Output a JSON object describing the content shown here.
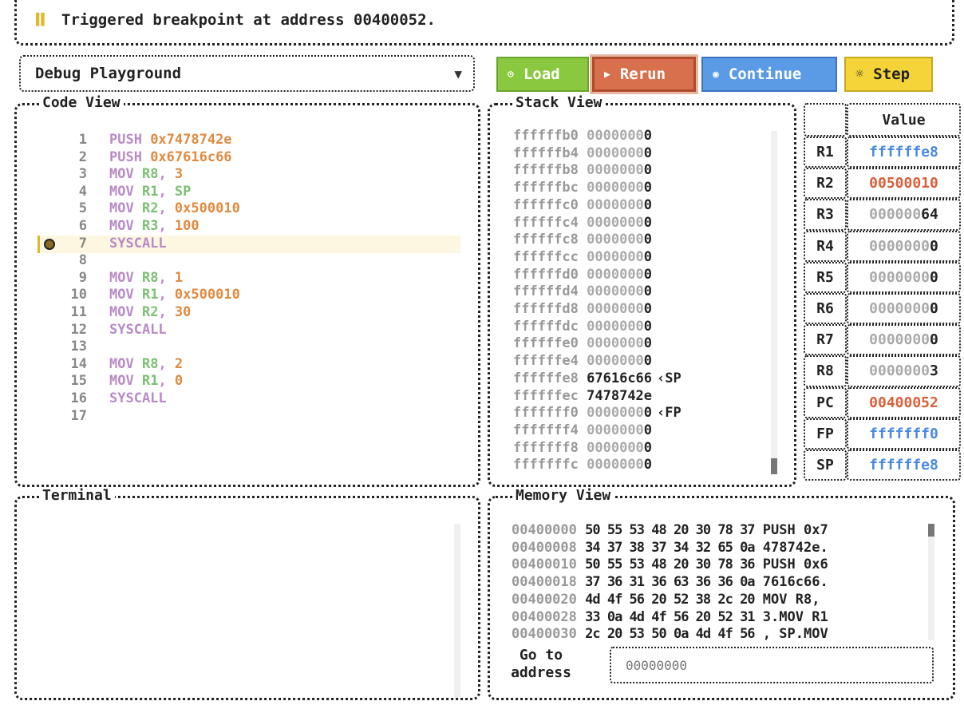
{
  "status": {
    "message": "Triggered breakpoint at address 00400052."
  },
  "program": {
    "selected": "Debug Playground"
  },
  "toolbar": {
    "load": "Load",
    "rerun": "Rerun",
    "continue": "Continue",
    "step": "Step"
  },
  "code": {
    "title": "Code View",
    "lines": [
      {
        "n": "1",
        "parts": [
          [
            "kw",
            "PUSH "
          ],
          [
            "nm",
            "0x7478742e"
          ]
        ]
      },
      {
        "n": "2",
        "parts": [
          [
            "kw",
            "PUSH "
          ],
          [
            "nm",
            "0x67616c66"
          ]
        ]
      },
      {
        "n": "3",
        "parts": [
          [
            "kw",
            "MOV "
          ],
          [
            "rg",
            "R8"
          ],
          [
            "kw",
            ", "
          ],
          [
            "nm",
            "3"
          ]
        ]
      },
      {
        "n": "4",
        "parts": [
          [
            "kw",
            "MOV "
          ],
          [
            "rg",
            "R1"
          ],
          [
            "kw",
            ", "
          ],
          [
            "rg",
            "SP"
          ]
        ]
      },
      {
        "n": "5",
        "parts": [
          [
            "kw",
            "MOV "
          ],
          [
            "rg",
            "R2"
          ],
          [
            "kw",
            ", "
          ],
          [
            "nm",
            "0x500010"
          ]
        ]
      },
      {
        "n": "6",
        "parts": [
          [
            "kw",
            "MOV "
          ],
          [
            "rg",
            "R3"
          ],
          [
            "kw",
            ", "
          ],
          [
            "nm",
            "100"
          ]
        ]
      },
      {
        "n": "7",
        "parts": [
          [
            "kw",
            "SYSCALL"
          ]
        ],
        "active": true
      },
      {
        "n": "8",
        "parts": []
      },
      {
        "n": "9",
        "parts": [
          [
            "kw",
            "MOV "
          ],
          [
            "rg",
            "R8"
          ],
          [
            "kw",
            ", "
          ],
          [
            "nm",
            "1"
          ]
        ]
      },
      {
        "n": "10",
        "parts": [
          [
            "kw",
            "MOV "
          ],
          [
            "rg",
            "R1"
          ],
          [
            "kw",
            ", "
          ],
          [
            "nm",
            "0x500010"
          ]
        ]
      },
      {
        "n": "11",
        "parts": [
          [
            "kw",
            "MOV "
          ],
          [
            "rg",
            "R2"
          ],
          [
            "kw",
            ", "
          ],
          [
            "nm",
            "30"
          ]
        ]
      },
      {
        "n": "12",
        "parts": [
          [
            "kw",
            "SYSCALL"
          ]
        ]
      },
      {
        "n": "13",
        "parts": []
      },
      {
        "n": "14",
        "parts": [
          [
            "kw",
            "MOV "
          ],
          [
            "rg",
            "R8"
          ],
          [
            "kw",
            ", "
          ],
          [
            "nm",
            "2"
          ]
        ]
      },
      {
        "n": "15",
        "parts": [
          [
            "kw",
            "MOV "
          ],
          [
            "rg",
            "R1"
          ],
          [
            "kw",
            ", "
          ],
          [
            "nm",
            "0"
          ]
        ]
      },
      {
        "n": "16",
        "parts": [
          [
            "kw",
            "SYSCALL"
          ]
        ]
      },
      {
        "n": "17",
        "parts": []
      }
    ]
  },
  "stack": {
    "title": "Stack View",
    "rows": [
      {
        "addr": "ffffffb0",
        "val": "00000000",
        "mark": ""
      },
      {
        "addr": "ffffffb4",
        "val": "00000000",
        "mark": ""
      },
      {
        "addr": "ffffffb8",
        "val": "00000000",
        "mark": ""
      },
      {
        "addr": "ffffffbc",
        "val": "00000000",
        "mark": ""
      },
      {
        "addr": "ffffffc0",
        "val": "00000000",
        "mark": ""
      },
      {
        "addr": "ffffffc4",
        "val": "00000000",
        "mark": ""
      },
      {
        "addr": "ffffffc8",
        "val": "00000000",
        "mark": ""
      },
      {
        "addr": "ffffffcc",
        "val": "00000000",
        "mark": ""
      },
      {
        "addr": "ffffffd0",
        "val": "00000000",
        "mark": ""
      },
      {
        "addr": "ffffffd4",
        "val": "00000000",
        "mark": ""
      },
      {
        "addr": "ffffffd8",
        "val": "00000000",
        "mark": ""
      },
      {
        "addr": "ffffffdc",
        "val": "00000000",
        "mark": ""
      },
      {
        "addr": "ffffffe0",
        "val": "00000000",
        "mark": ""
      },
      {
        "addr": "ffffffe4",
        "val": "00000000",
        "mark": ""
      },
      {
        "addr": "ffffffe8",
        "val": "67616c66",
        "mark": "‹SP"
      },
      {
        "addr": "ffffffec",
        "val": "7478742e",
        "mark": ""
      },
      {
        "addr": "fffffff0",
        "val": "00000000",
        "mark": "‹FP"
      },
      {
        "addr": "fffffff4",
        "val": "00000000",
        "mark": ""
      },
      {
        "addr": "fffffff8",
        "val": "00000000",
        "mark": ""
      },
      {
        "addr": "fffffffc",
        "val": "00000000",
        "mark": ""
      }
    ]
  },
  "registers": {
    "header": "Value",
    "rows": [
      {
        "name": "R1",
        "val": "ffffffe8",
        "style": "blue"
      },
      {
        "name": "R2",
        "val": "00500010",
        "style": "red"
      },
      {
        "name": "R3",
        "val": "00000064",
        "style": "zero"
      },
      {
        "name": "R4",
        "val": "00000000",
        "style": "zero"
      },
      {
        "name": "R5",
        "val": "00000000",
        "style": "zero"
      },
      {
        "name": "R6",
        "val": "00000000",
        "style": "zero"
      },
      {
        "name": "R7",
        "val": "00000000",
        "style": "zero"
      },
      {
        "name": "R8",
        "val": "00000003",
        "style": "zero"
      },
      {
        "name": "PC",
        "val": "00400052",
        "style": "red"
      },
      {
        "name": "FP",
        "val": "fffffff0",
        "style": "blue"
      },
      {
        "name": "SP",
        "val": "ffffffe8",
        "style": "blue"
      }
    ]
  },
  "terminal": {
    "title": "Terminal"
  },
  "memory": {
    "title": "Memory View",
    "rows": [
      {
        "addr": "00400000",
        "hex": "50 55 53 48 20 30 78 37",
        "asc": "PUSH 0x7"
      },
      {
        "addr": "00400008",
        "hex": "34 37 38 37 34 32 65 0a",
        "asc": "478742e."
      },
      {
        "addr": "00400010",
        "hex": "50 55 53 48 20 30 78 36",
        "asc": "PUSH 0x6"
      },
      {
        "addr": "00400018",
        "hex": "37 36 31 36 63 36 36 0a",
        "asc": "7616c66."
      },
      {
        "addr": "00400020",
        "hex": "4d 4f 56 20 52 38 2c 20",
        "asc": "MOV R8, "
      },
      {
        "addr": "00400028",
        "hex": "33 0a 4d 4f 56 20 52 31",
        "asc": "3.MOV R1"
      },
      {
        "addr": "00400030",
        "hex": "2c 20 53 50 0a 4d 4f 56",
        "asc": ", SP.MOV"
      }
    ],
    "goto_label": "Go to address",
    "goto_placeholder": "00000000"
  }
}
